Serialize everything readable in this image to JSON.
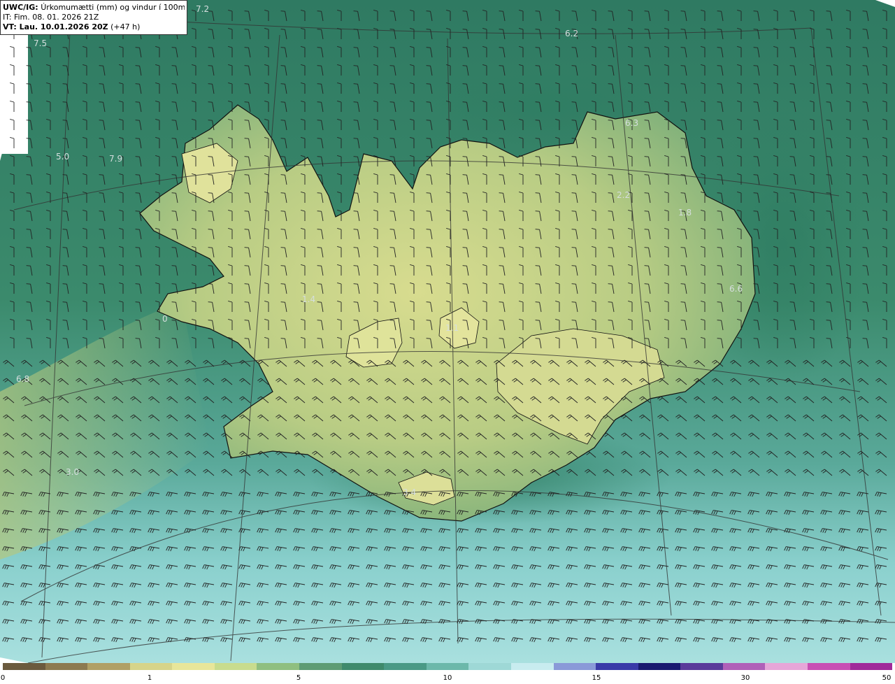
{
  "header": {
    "model_label": "UWC/IG:",
    "title": "Úrkomumætti (mm) og vindur í 100m hæð",
    "issue_time": "IT: Fim. 08. 01. 2026 21Z",
    "valid_label": "VT: Lau. 10.01.2026 20Z",
    "valid_offset": "(+47 h)"
  },
  "map": {
    "region": "Iceland",
    "colors": {
      "ocean_north": "#2f7a62",
      "ocean_south": "#7cc9c8",
      "land_dry": "#c9d98a",
      "land_moist": "#4f9a72",
      "coastline": "#111111",
      "wind_barb": "#222222",
      "grid_line": "#333333"
    },
    "value_labels": [
      "7.2",
      "7.5",
      "6.2",
      "5.0",
      "7.9",
      "6.3",
      "2.2",
      "1.8",
      "6.6",
      "1.4",
      "0",
      "1.1",
      "6.8",
      "3.0",
      "3.4"
    ]
  },
  "colorbar": {
    "ticks": [
      "0",
      "1",
      "5",
      "10",
      "15",
      "30",
      "50"
    ],
    "colors": [
      "#6b5a3e",
      "#8c7a50",
      "#b0a066",
      "#d6d48a",
      "#e8e69a",
      "#c8dc8e",
      "#8fbf80",
      "#5e9c74",
      "#3f8a6c",
      "#4a9a86",
      "#6cb8aa",
      "#9ed8d6",
      "#c8ecef",
      "#8a9ad8",
      "#3a3aa8",
      "#1a1a70",
      "#5a3a9a",
      "#b060b8",
      "#e6a6d8",
      "#c84fb4",
      "#a02a9a"
    ]
  }
}
